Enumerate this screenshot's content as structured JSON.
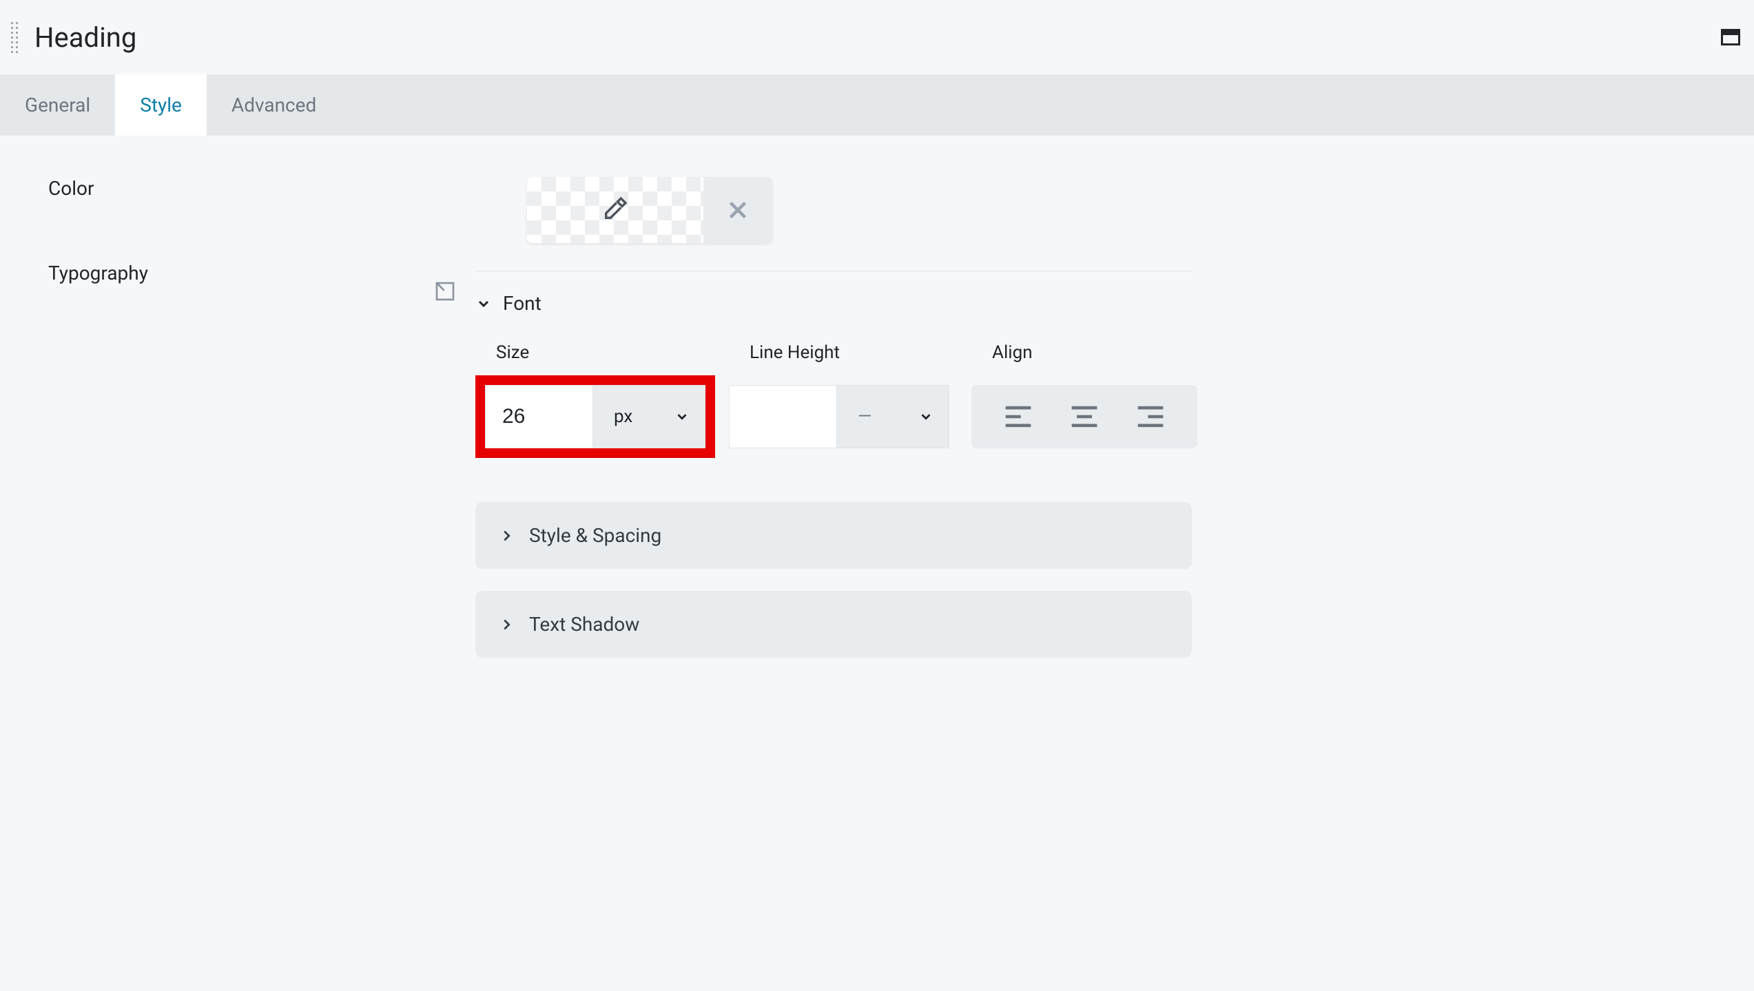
{
  "header": {
    "title": "Heading"
  },
  "tabs": {
    "general": "General",
    "style": "Style",
    "advanced": "Advanced"
  },
  "style": {
    "color_label": "Color",
    "typography_label": "Typography",
    "font_section": "Font",
    "size_label": "Size",
    "line_height_label": "Line Height",
    "align_label": "Align",
    "size_value": "26",
    "size_unit": "px",
    "line_height_value": "",
    "line_height_unit": "—",
    "style_spacing_panel": "Style & Spacing",
    "text_shadow_panel": "Text Shadow"
  }
}
